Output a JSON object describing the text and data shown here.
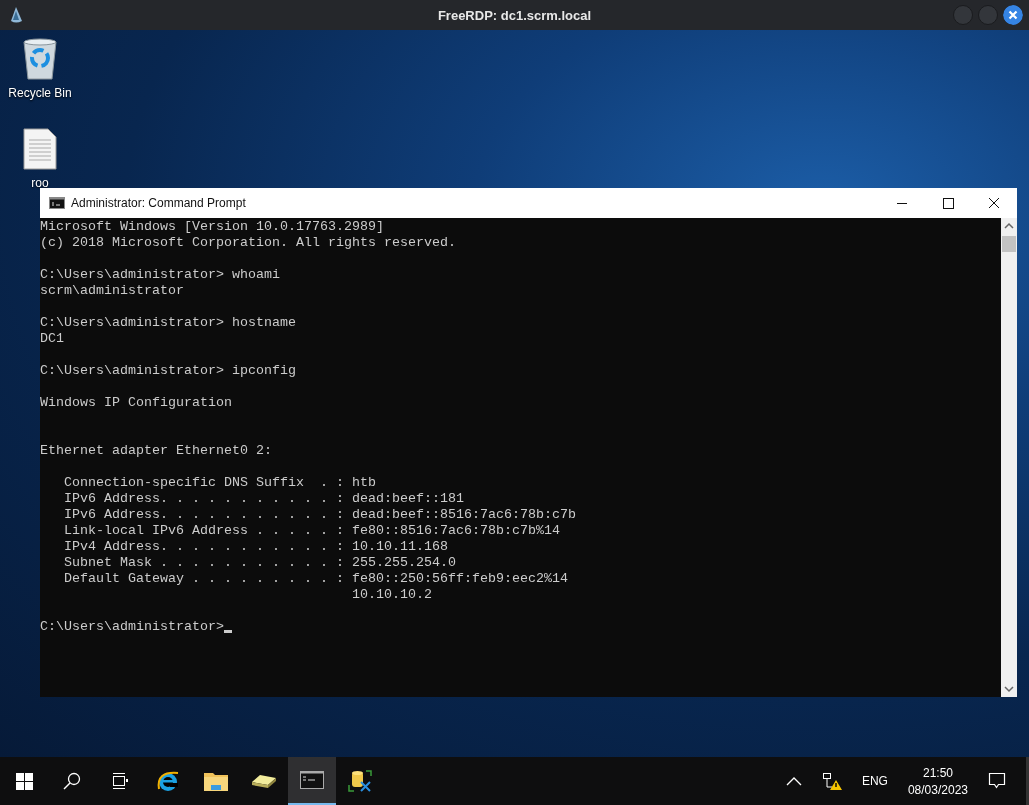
{
  "window": {
    "title": "FreeRDP: dc1.scrm.local"
  },
  "desktop": {
    "icons": [
      {
        "label": "Recycle Bin",
        "kind": "recycle"
      },
      {
        "label": "roo",
        "kind": "document"
      }
    ]
  },
  "console": {
    "title": "Administrator: Command Prompt",
    "output": "Microsoft Windows [Version 10.0.17763.2989]\n(c) 2018 Microsoft Corporation. All rights reserved.\n\nC:\\Users\\administrator> whoami\nscrm\\administrator\n\nC:\\Users\\administrator> hostname\nDC1\n\nC:\\Users\\administrator> ipconfig\n\nWindows IP Configuration\n\n\nEthernet adapter Ethernet0 2:\n\n   Connection-specific DNS Suffix  . : htb\n   IPv6 Address. . . . . . . . . . . : dead:beef::181\n   IPv6 Address. . . . . . . . . . . : dead:beef::8516:7ac6:78b:c7b\n   Link-local IPv6 Address . . . . . : fe80::8516:7ac6:78b:c7b%14\n   IPv4 Address. . . . . . . . . . . : 10.10.11.168\n   Subnet Mask . . . . . . . . . . . : 255.255.254.0\n   Default Gateway . . . . . . . . . : fe80::250:56ff:feb9:eec2%14\n                                       10.10.10.2",
    "prompt": "C:\\Users\\administrator>"
  },
  "taskbar": {
    "items": [
      {
        "kind": "start",
        "selected": false
      },
      {
        "kind": "search",
        "selected": false
      },
      {
        "kind": "taskview",
        "selected": false
      },
      {
        "kind": "browser",
        "selected": false
      },
      {
        "kind": "folder",
        "selected": false
      },
      {
        "kind": "drive",
        "selected": false
      },
      {
        "kind": "console",
        "selected": true
      },
      {
        "kind": "tools",
        "selected": false
      }
    ],
    "language": "ENG",
    "time": "21:50",
    "date": "08/03/2023"
  }
}
